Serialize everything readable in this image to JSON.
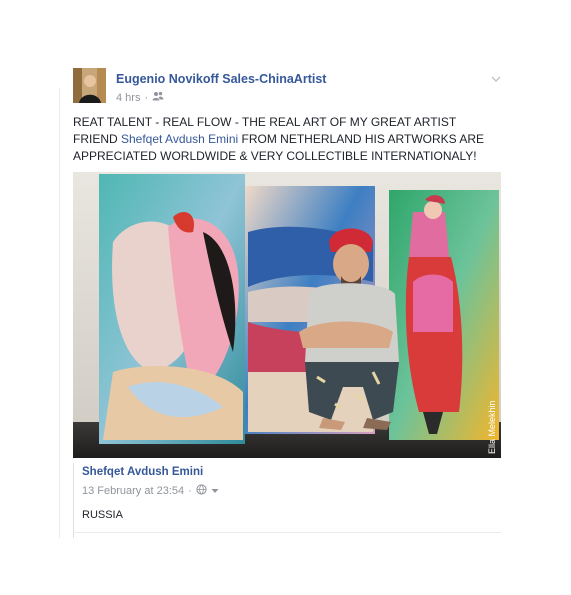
{
  "post": {
    "author": "Eugenio Novikoff Sales-ChinaArtist",
    "time": "4 hrs",
    "meta_sep": "·",
    "audience_icon": "friends-icon",
    "menu_icon": "chevron-down-icon",
    "text_prefix": "REAT TALENT - REAL FLOW - THE REAL ART OF MY GREAT ARTIST FRIEND ",
    "mention": "Shefqet Avdush Emini",
    "text_suffix": " FROM NETHERLAND HIS ARTWORKS ARE APPRECIATED WORLDWIDE & VERY COLLECTIBLE INTERNATIONALY!",
    "photo_watermark": "Ella Melekhin"
  },
  "shared": {
    "name": "Shefqet Avdush Emini",
    "date": "13 February at 23:54",
    "meta_sep": "·",
    "privacy_icon": "globe-icon",
    "dropdown_icon": "caret-down-icon",
    "text": "RUSSIA"
  },
  "colors": {
    "link": "#365899",
    "meta": "#90949c",
    "text": "#1d2129",
    "divider": "#e9ebee"
  }
}
